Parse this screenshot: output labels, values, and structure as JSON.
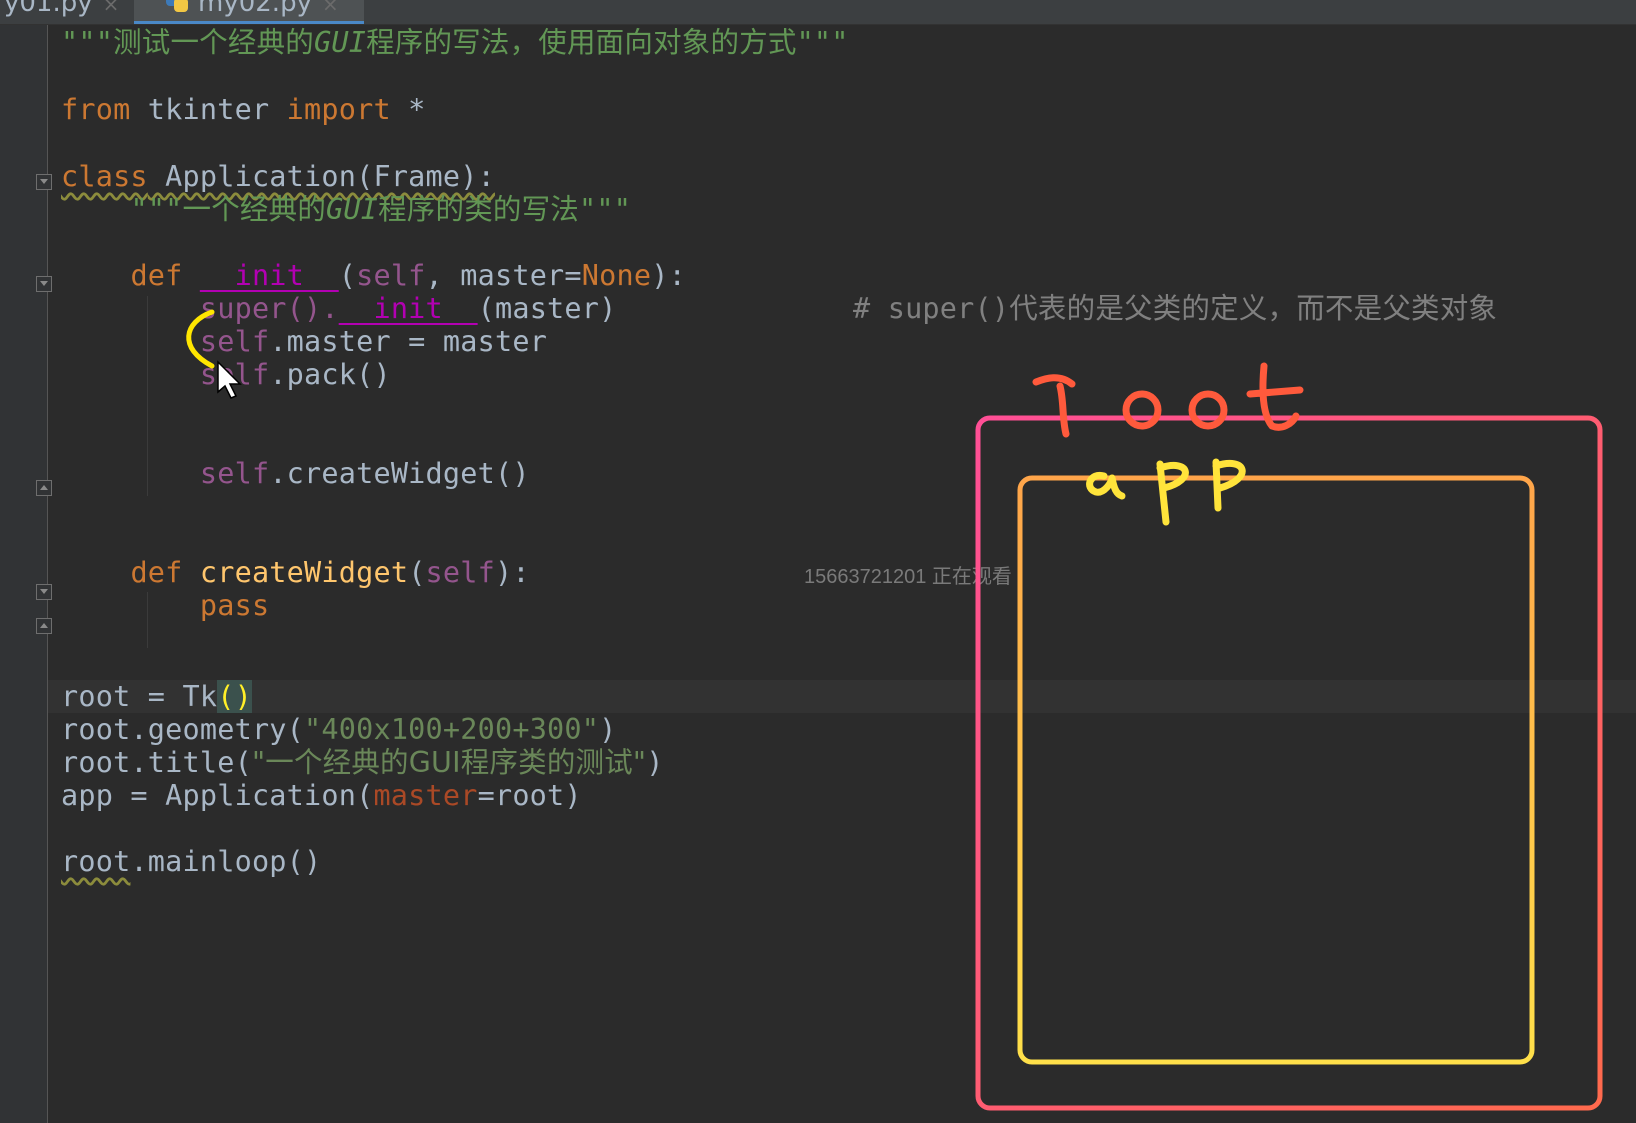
{
  "tabs": [
    {
      "label": "y01.py",
      "close": "×",
      "active": false
    },
    {
      "label": "my02.py",
      "close": "×",
      "active": true
    }
  ],
  "code": {
    "l1_q": "\"\"\"",
    "l1_text": "测试一个经典的",
    "l1_gui": "GUI",
    "l1_text2": "程序的写法，使用面向对象的方式",
    "l1_q2": "\"\"\"",
    "l3_from": "from",
    "l3_mod": " tkinter ",
    "l3_import": "import",
    "l3_star": " *",
    "l5_class": "class",
    "l5_name": " Application(Frame):",
    "l6_q": "\"\"\"",
    "l6_text": "一个经典的",
    "l6_gui": "GUI",
    "l6_text2": "程序的类的写法",
    "l6_q2": "\"\"\"",
    "l8_def": "def",
    "l8_init": "__init__",
    "l8_open": "(",
    "l8_self": "self",
    "l8_rest": ", master=",
    "l8_none": "None",
    "l8_close": "):",
    "l9_super": "super().",
    "l9_init": "__init__",
    "l9_rest": "(master)",
    "l9_comment": "# super()代表的是父类的定义，而不是父类对象",
    "l10_self": "self",
    "l10_rest": ".master = master",
    "l11_self": "self",
    "l11_rest": ".pack()",
    "l14_self": "self",
    "l14_rest": ".createWidget()",
    "l17_def": "def",
    "l17_fn": "createWidget",
    "l17_open": "(",
    "l17_self": "self",
    "l17_close": "):",
    "l18_pass": "pass",
    "l21_a": "root = Tk",
    "l21_paren": "()",
    "l22_a": "root.geometry(",
    "l22_str": "\"400x100+200+300\"",
    "l22_b": ")",
    "l23_a": "root.title(",
    "l23_str": "\"一个经典的GUI程序类的测试\"",
    "l23_b": ")",
    "l24_a": "app = Application(",
    "l24_param": "master",
    "l24_b": "=root)",
    "l26_root": "root",
    "l26_rest": ".mainloop()"
  },
  "annotations": {
    "outer_label": "root",
    "inner_label": "app",
    "outer_color": "#ff4f86",
    "inner_color": "#ffd43b",
    "bracket_color": "#ffe600"
  },
  "watermark": "15663721201 正在观看"
}
